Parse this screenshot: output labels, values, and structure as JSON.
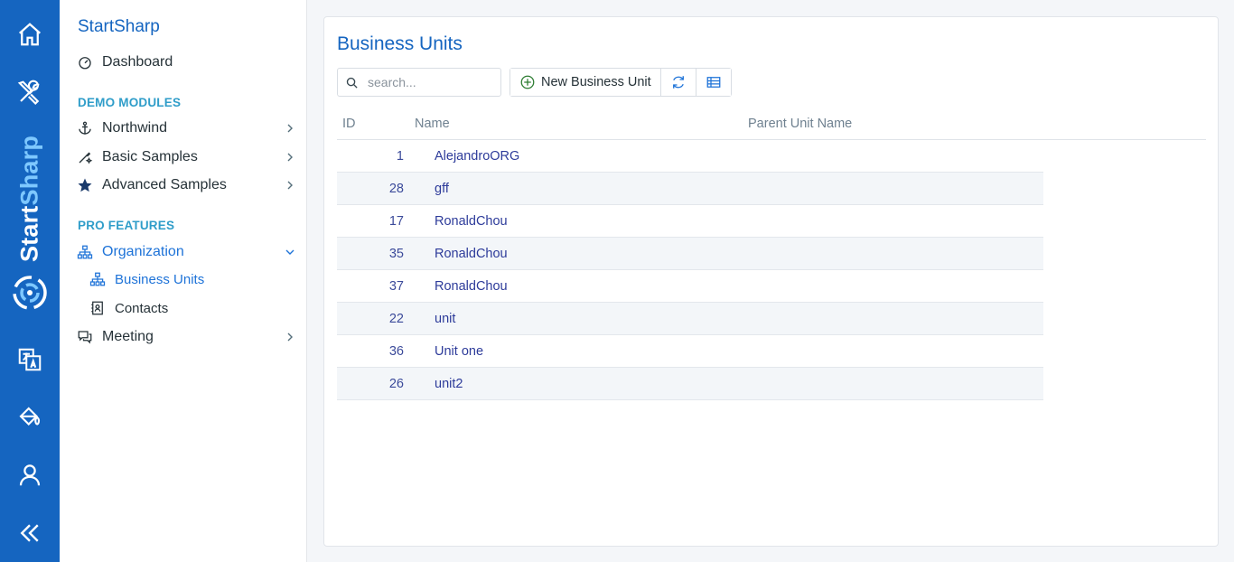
{
  "rail": {
    "brand_start": "Start",
    "brand_sharp": "Sharp",
    "icons": [
      "home-icon",
      "tools-icon",
      "translate-icon",
      "theme-icon",
      "user-icon",
      "collapse-icon"
    ]
  },
  "sidebar": {
    "title": "StartSharp",
    "dashboard": "Dashboard",
    "section_demo": "DEMO MODULES",
    "northwind": "Northwind",
    "basic_samples": "Basic Samples",
    "advanced_samples": "Advanced Samples",
    "section_pro": "PRO FEATURES",
    "organization": "Organization",
    "business_units": "Business Units",
    "contacts": "Contacts",
    "meeting": "Meeting"
  },
  "main": {
    "title": "Business Units",
    "search_placeholder": "search...",
    "new_button": "New Business Unit",
    "columns": {
      "id": "ID",
      "name": "Name",
      "parent": "Parent Unit Name"
    },
    "rows": [
      {
        "id": "1",
        "name": "AlejandroORG"
      },
      {
        "id": "28",
        "name": "gff"
      },
      {
        "id": "17",
        "name": "RonaldChou"
      },
      {
        "id": "35",
        "name": "RonaldChou"
      },
      {
        "id": "37",
        "name": "RonaldChou"
      },
      {
        "id": "22",
        "name": "unit"
      },
      {
        "id": "36",
        "name": "Unit one"
      },
      {
        "id": "26",
        "name": "unit2"
      }
    ]
  },
  "colors": {
    "rail": "#1565c0",
    "accent": "#1e73d8",
    "section": "#2f9dc9",
    "link": "#2d3b9a",
    "add_icon": "#2e7d32"
  }
}
